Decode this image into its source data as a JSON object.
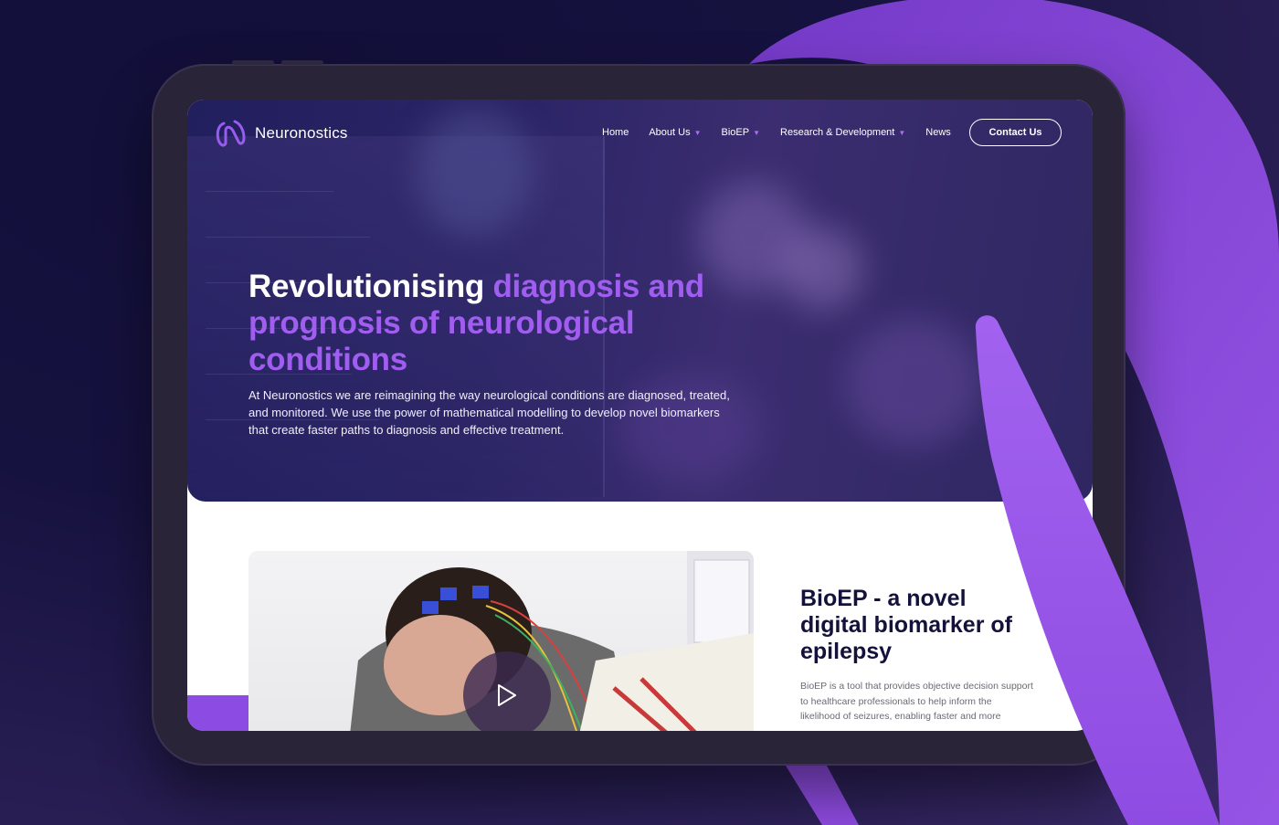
{
  "brand": {
    "name": "Neuronostics"
  },
  "nav": {
    "items": [
      {
        "label": "Home",
        "has_dropdown": false
      },
      {
        "label": "About Us",
        "has_dropdown": true
      },
      {
        "label": "BioEP",
        "has_dropdown": true
      },
      {
        "label": "Research & Development",
        "has_dropdown": true
      },
      {
        "label": "News",
        "has_dropdown": false
      }
    ],
    "cta": "Contact Us"
  },
  "hero": {
    "title_white": "Revolutionising ",
    "title_accent": "diagnosis and prognosis of neurological conditions",
    "description": "At Neuronostics we are reimagining the way neurological conditions are diagnosed, treated, and monitored. We use the power of mathematical modelling to develop novel biomarkers that create faster paths to diagnosis and effective treatment."
  },
  "bioep": {
    "title": "BioEP - a novel digital biomarker of epilepsy",
    "description": "BioEP is a tool that provides objective decision support to healthcare professionals to help inform the likelihood of seizures, enabling faster and more"
  },
  "colors": {
    "accent": "#a05df0",
    "brand_purple": "#8c4be3",
    "hero_bg": "#2b2566",
    "dark_text": "#14123a"
  },
  "icons": {
    "logo": "neuronostics-logo-icon",
    "play": "play-icon",
    "dropdown": "chevron-down-icon"
  }
}
